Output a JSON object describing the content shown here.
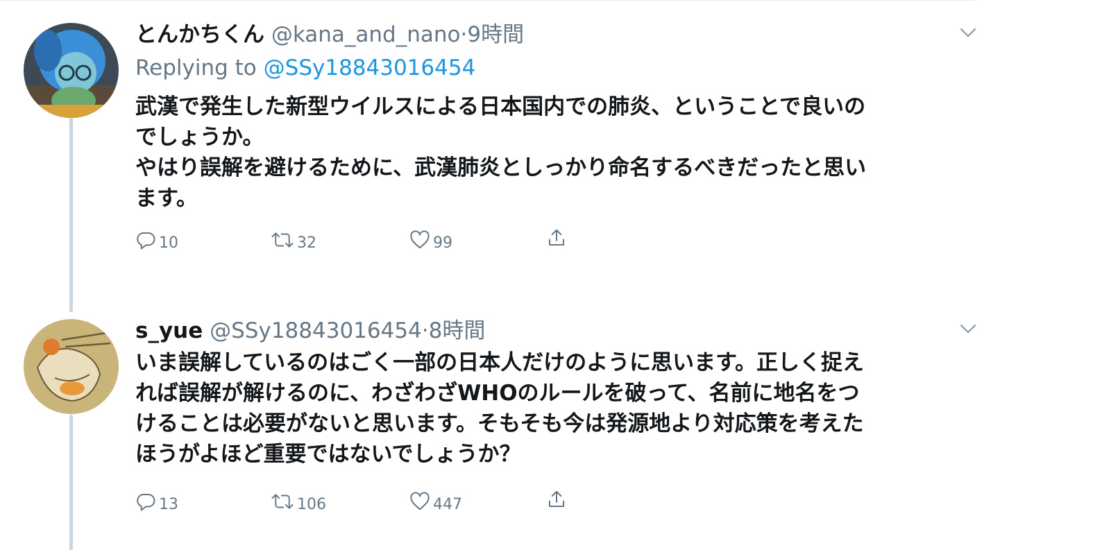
{
  "tweets": [
    {
      "display_name": "とんかちくん",
      "handle": "@kana_and_nano",
      "separator": "·",
      "time": "9時間",
      "replying_prefix": "Replying to",
      "replying_to": "@SSy18843016454",
      "text": "武漢で発生した新型ウイルスによる日本国内での肺炎、ということで良いのでしょうか。\nやはり誤解を避けるために、武漢肺炎としっかり命名するべきだったと思います。",
      "text_lines": [
        "武漢で発生した新型ウイルスによる日本国内での肺炎、ということで良いの",
        "でしょうか。",
        "やはり誤解を避けるために、武漢肺炎としっかり命名するべきだったと思い",
        "ます。"
      ],
      "replies": "10",
      "retweets": "32",
      "likes": "99",
      "avatar_icon": "avatar-blue-character"
    },
    {
      "display_name": "s_yue",
      "handle": "@SSy18843016454",
      "separator": "·",
      "time": "8時間",
      "text_lines": [
        "いま誤解しているのはごく一部の日本人だけのように思います。正しく捉え",
        "れば誤解が解けるのに、わざわざWHOのルールを破って、名前に地名をつ",
        "けることは必要がないと思います。そもそも今は発源地より対応策を考えた",
        "ほうがよほど重要ではないでしょうか？"
      ],
      "replies": "13",
      "retweets": "106",
      "likes": "447",
      "avatar_icon": "avatar-drawing"
    }
  ],
  "icons": {
    "reply": "reply-icon",
    "retweet": "retweet-icon",
    "like": "like-icon",
    "share": "share-icon",
    "caret": "chevron-down-icon"
  },
  "colors": {
    "link": "#1b95e0",
    "secondary": "#657786",
    "thread_line": "#ccd6dd"
  }
}
